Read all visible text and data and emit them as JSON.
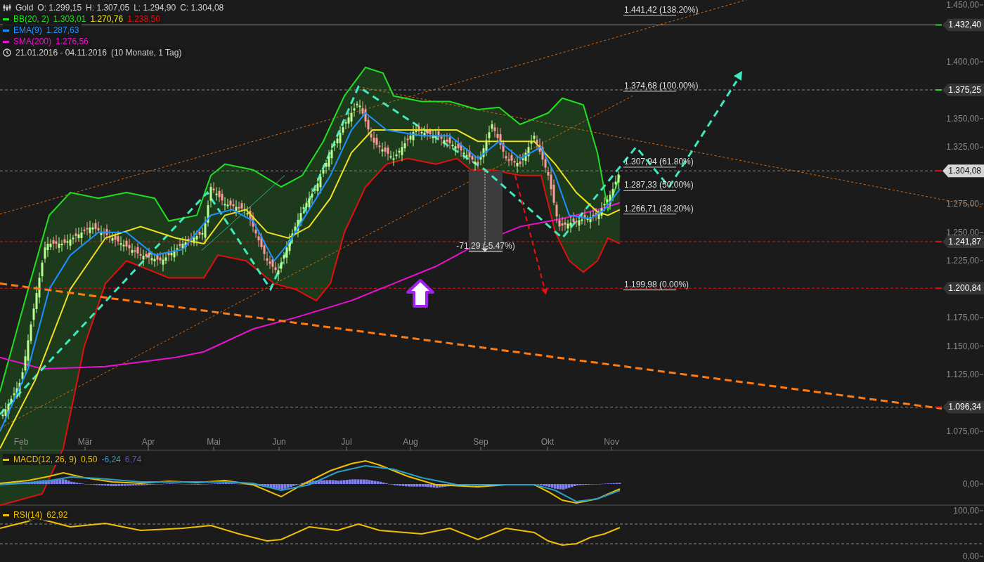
{
  "symbol": {
    "name": "Gold",
    "ohlc": [
      "O: 1.299,15",
      "H: 1.307,05",
      "L: 1.294,90",
      "C: 1.304,08"
    ]
  },
  "indicators": [
    {
      "name": "BB(20, 2)",
      "color": "#22dd22",
      "values": [
        {
          "text": "1.303,01",
          "color": "#22dd22"
        },
        {
          "text": "1.270,76",
          "color": "#f0e020"
        },
        {
          "text": "1.238,50",
          "color": "#e01010"
        }
      ]
    },
    {
      "name": "EMA(9)",
      "color": "#1e90ff",
      "values": [
        {
          "text": "1.287,63",
          "color": "#1e90ff"
        }
      ]
    },
    {
      "name": "SMA(200)",
      "color": "#ee10d0",
      "values": [
        {
          "text": "1.276,56",
          "color": "#ee10d0"
        }
      ]
    }
  ],
  "period": {
    "range": "21.01.2016 - 04.11.2016",
    "duration": "(10 Monate, 1 Tag)"
  },
  "price_axis": {
    "ticks": [
      "1.450,00",
      "1.400,00",
      "1.350,00",
      "1.325,00",
      "1.275,00",
      "1.250,00",
      "1.225,00",
      "1.175,00",
      "1.150,00",
      "1.125,00",
      "1.075,00"
    ]
  },
  "price_markers": [
    {
      "value": "1.432,40",
      "kind": "solid",
      "color": "#22dd22"
    },
    {
      "value": "1.375,25",
      "kind": "guide",
      "color": "#22dd22"
    },
    {
      "value": "1.304,08",
      "kind": "current",
      "color": "#e01010"
    },
    {
      "value": "1.241,87",
      "kind": "support",
      "color": "#e01010"
    },
    {
      "value": "1.200,84",
      "kind": "support",
      "color": "#e01010"
    },
    {
      "value": "1.096,34",
      "kind": "guide",
      "color": "#e01010"
    }
  ],
  "fibonacci_levels": [
    "1.441,42 (138.20%)",
    "1.374,68 (100.00%)",
    "1.307,94 (61.80%)",
    "1.287,33 (50.00%)",
    "1.266,71 (38.20%)",
    "1.199,98 (0.00%)"
  ],
  "measurement": "-71,29 (-5.47%)",
  "months": [
    "Feb",
    "Mär",
    "Apr",
    "Mai",
    "Jun",
    "Jul",
    "Aug",
    "Sep",
    "Okt",
    "Nov"
  ],
  "macd": {
    "name": "MACD(12, 26, 9)",
    "values": [
      {
        "text": "0,50",
        "color": "#f0c000"
      },
      {
        "text": "-6,24",
        "color": "#2a9fc6"
      },
      {
        "text": "6,74",
        "color": "#5a5ab8"
      }
    ],
    "axis": [
      "0,00"
    ]
  },
  "rsi": {
    "name": "RSI(14)",
    "value": "62,92",
    "axis": [
      "100,00",
      "0,00"
    ]
  }
}
